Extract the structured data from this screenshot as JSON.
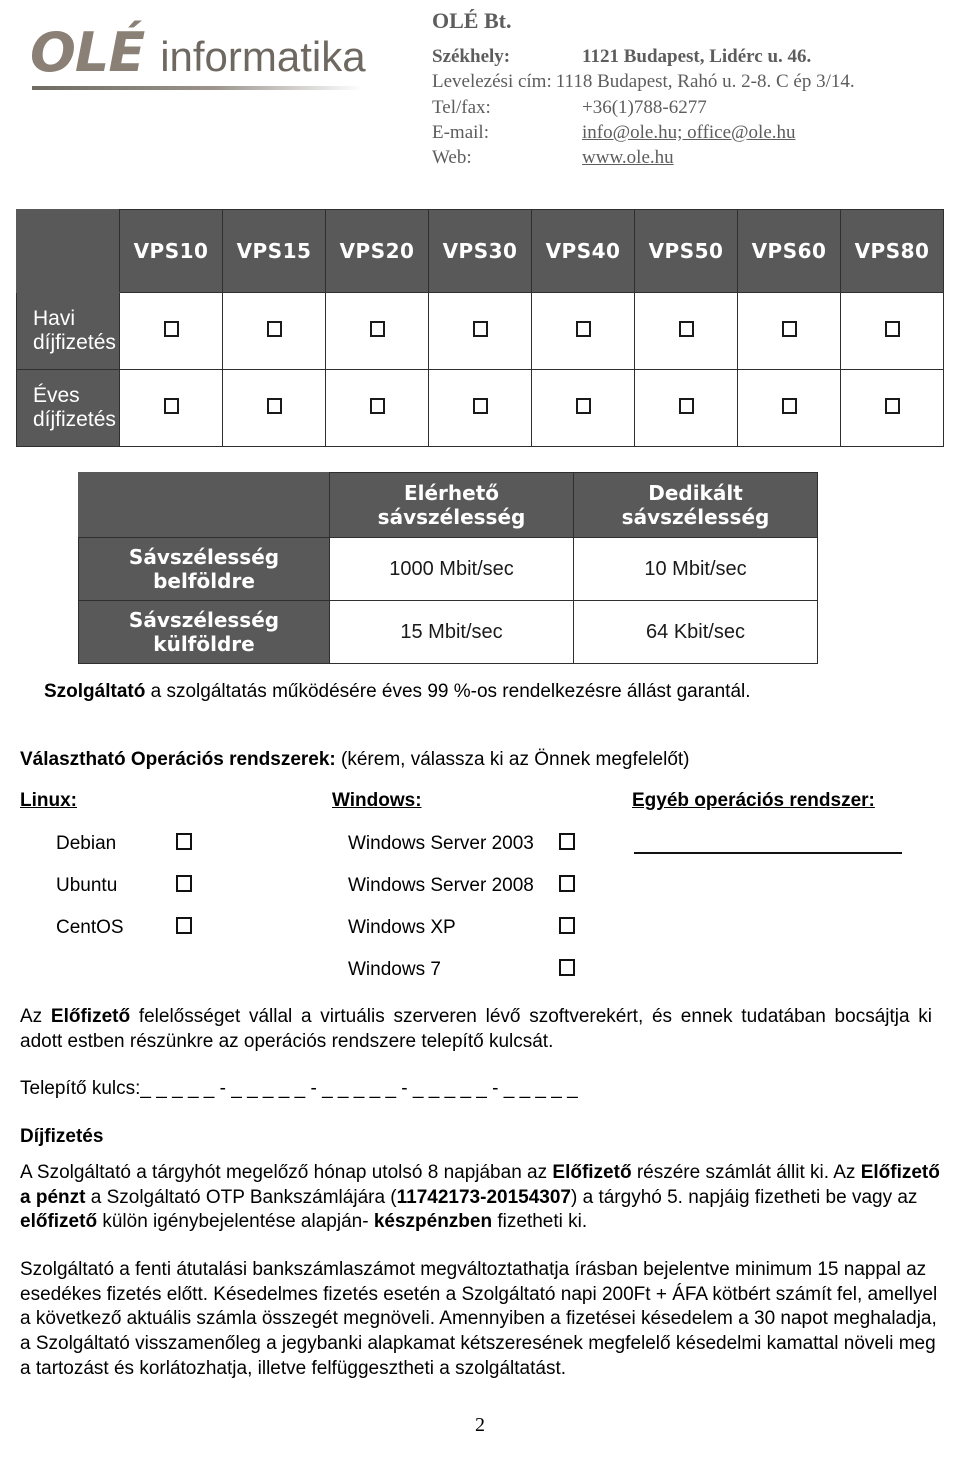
{
  "letterhead": {
    "logo": {
      "mark_text": "OLÉ",
      "word_text": "informatika"
    },
    "company_name": "OLÉ Bt.",
    "address_lines": [
      {
        "label": "Székhely:",
        "value": "1121 Budapest, Lidérc u. 46.",
        "bold": true,
        "underline": false
      },
      {
        "label": "Levelezési cím:",
        "value": "1118 Budapest, Rahó u. 2-8. C ép 3/14.",
        "bold": false,
        "underline": false
      },
      {
        "label": "Tel/fax:",
        "value": "+36(1)788-6277",
        "bold": false,
        "underline": false
      },
      {
        "label": "E-mail:",
        "value": "info@ole.hu; office@ole.hu",
        "bold": false,
        "underline": true
      },
      {
        "label": "Web:",
        "value": "www.ole.hu",
        "bold": false,
        "underline": true
      }
    ]
  },
  "vps_table": {
    "corner_label": "",
    "plans": [
      "VPS10",
      "VPS15",
      "VPS20",
      "VPS30",
      "VPS40",
      "VPS50",
      "VPS60",
      "VPS80"
    ],
    "rows": [
      {
        "label": "Havi díjfizetés",
        "checked": [
          false,
          false,
          false,
          false,
          false,
          false,
          false,
          false
        ]
      },
      {
        "label": "Éves díjfizetés",
        "checked": [
          false,
          false,
          false,
          false,
          false,
          false,
          false,
          false
        ]
      }
    ]
  },
  "bandwidth_table": {
    "corner_label": "",
    "columns": [
      "Elérhető sávszélesség",
      "Dedikált sávszélesség"
    ],
    "rows": [
      {
        "label": "Sávszélesség belföldre",
        "values": [
          "1000 Mbit/sec",
          "10 Mbit/sec"
        ]
      },
      {
        "label": "Sávszélesség külföldre",
        "values": [
          "15 Mbit/sec",
          "64 Kbit/sec"
        ]
      }
    ]
  },
  "guarantee": {
    "bold_lead": "Szolgáltató",
    "rest": " a szolgáltatás működésére éves 99 %-os rendelkezésre állást garantál."
  },
  "os_choice": {
    "bold_lead": "Választható Operációs rendszerek:",
    "rest": " (kérem, válassza ki az Önnek megfelelőt)",
    "headings": {
      "linux": "Linux:",
      "windows": "Windows:",
      "other": "Egyéb operációs rendszer:"
    },
    "linux_items": [
      "Debian",
      "Ubuntu",
      "CentOS"
    ],
    "windows_items": [
      "Windows Server 2003",
      "Windows Server 2008",
      "Windows XP",
      "Windows 7"
    ],
    "other_value": ""
  },
  "liability": {
    "lead": "Az ",
    "bold": "Előfizető",
    "rest": " felelősséget vállal a virtuális szerveren lévő szoftverekért, és ennek tudatában bocsájtja ki adott estben részünkre az operációs rendszere telepítő kulcsát."
  },
  "install_key": {
    "label": "Telepítő kulcs:",
    "value": "_ _ _ _ _ - _ _ _ _ _ - _ _ _ _ _ - _ _ _ _ _  - _ _ _ _ _"
  },
  "payment": {
    "heading": "Díjfizetés",
    "p1_a": "A Szolgáltató a tárgyhót megelőző hónap utolsó 8 napjában az ",
    "p1_b_bold": "Előfizető",
    "p1_c": " részére számlát állit ki. Az ",
    "p1_d_bold": "Előfizető a pénzt",
    "p1_e": " a Szolgáltató OTP Bankszámlájára (",
    "p1_account_bold": "11742173-20154307",
    "p1_f": ") a tárgyhó 5. napjáig fizetheti be vagy az ",
    "p1_g_bold": "előfizető",
    "p1_h": " külön igénybejelentése alapján- ",
    "p1_i_bold": "készpénzben",
    "p1_j": " fizetheti ki.",
    "p2": "Szolgáltató a fenti átutalási bankszámlaszámot megváltoztathatja írásban bejelentve minimum 15 nappal az esedékes fizetés előtt. Késedelmes fizetés esetén a Szolgáltató napi 200Ft + ÁFA kötbért számít fel, amellyel a következő aktuális számla összegét megnöveli. Amennyiben a fizetései késedelem a 30 napot meghaladja, a Szolgáltató visszamenőleg a jegybanki alapkamat kétszeresének megfelelő késedelmi kamattal növeli meg a tartozást és korlátozhatja, illetve felfüggesztheti a szolgáltatást."
  },
  "footer": {
    "page_number": "2"
  },
  "colors": {
    "table_header_gray": "#595959",
    "border_dark": "#2f2f2f",
    "letterhead_text": "#5d5d5d",
    "logo_mark": "#8a8076"
  }
}
